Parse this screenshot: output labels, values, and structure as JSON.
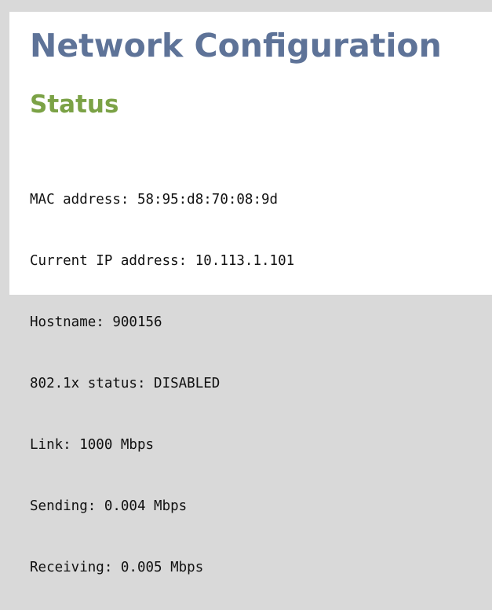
{
  "page": {
    "title": "Network Configuration"
  },
  "status": {
    "heading": "Status",
    "lines": [
      "MAC address: 58:95:d8:70:08:9d",
      "Current IP address: 10.113.1.101",
      "Hostname: 900156",
      "802.1x status: DISABLED",
      "Link: 1000 Mbps",
      "Sending: 0.004 Mbps",
      "Receiving: 0.005 Mbps"
    ]
  },
  "colors": {
    "title": "#5e7398",
    "heading": "#7ba246",
    "text": "#111111",
    "background": "#d9d9d9",
    "panel": "#ffffff"
  }
}
